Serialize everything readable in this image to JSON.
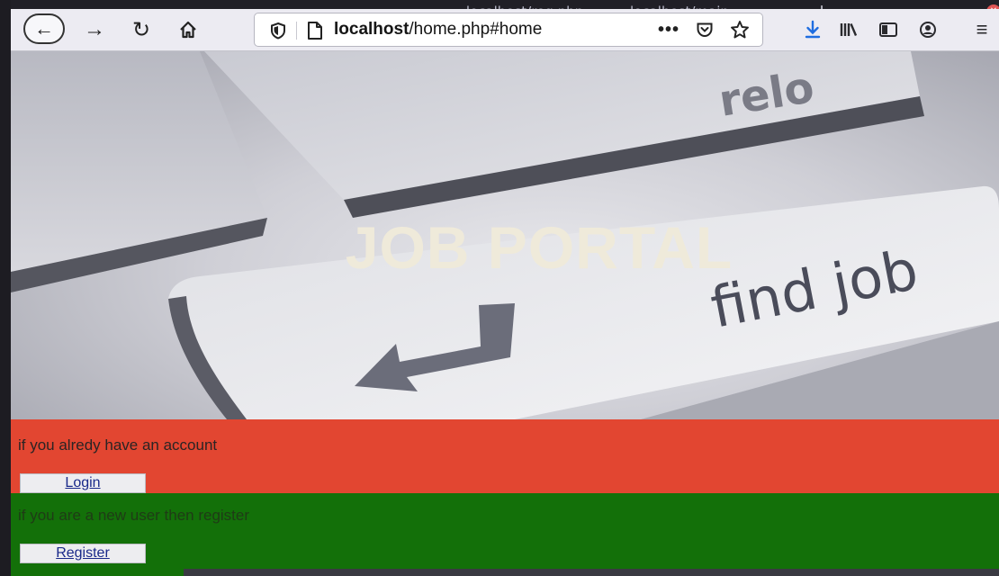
{
  "browser": {
    "tabs": [
      {
        "label": "localhost/reg.php"
      },
      {
        "label": "localhost/main"
      }
    ],
    "new_tab_label": "+",
    "url": {
      "host": "localhost",
      "path": "/home.php#home"
    },
    "more_label": "•••",
    "menu_label": "≡"
  },
  "hero": {
    "title": "JOB PORTAL",
    "caption": "find job"
  },
  "login_section": {
    "text": "if you alredy have an account",
    "button": "Login",
    "color": "#e24631"
  },
  "register_section": {
    "text": "if you are a new user then register",
    "button": "Register",
    "color": "#137009"
  }
}
